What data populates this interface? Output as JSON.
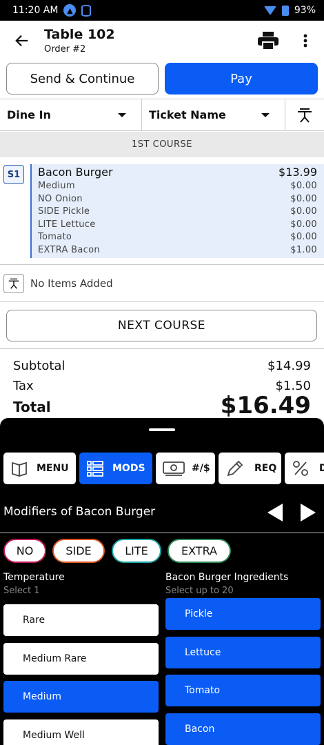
{
  "status": {
    "time": "11:20 AM",
    "battery": "93%"
  },
  "header": {
    "title": "Table 102",
    "subtitle": "Order #2"
  },
  "actions": {
    "send": "Send & Continue",
    "pay": "Pay"
  },
  "dropdowns": {
    "dine": "Dine In",
    "ticket": "Ticket Name"
  },
  "course": {
    "label": "1ST COURSE",
    "seat": "S1"
  },
  "item": {
    "name": "Bacon Burger",
    "price": "$13.99",
    "modifiers": [
      {
        "label": "Medium",
        "price": "$0.00"
      },
      {
        "label": "NO Onion",
        "price": "$0.00"
      },
      {
        "label": "SIDE Pickle",
        "price": "$0.00"
      },
      {
        "label": "LITE Lettuce",
        "price": "$0.00"
      },
      {
        "label": "Tomato",
        "price": "$0.00"
      },
      {
        "label": "EXTRA Bacon",
        "price": "$1.00"
      }
    ]
  },
  "no_items": "No Items Added",
  "next_course": "NEXT COURSE",
  "totals": {
    "subtotal_label": "Subtotal",
    "subtotal": "$14.99",
    "tax_label": "Tax",
    "tax": "$1.50",
    "total_label": "Total",
    "total": "$16.49"
  },
  "tabs": [
    "MENU",
    "MODS",
    "#/$",
    "REQ",
    "D"
  ],
  "active_tab": "MODS",
  "modifiers_title": "Modifiers of Bacon Burger",
  "chips": [
    {
      "label": "NO",
      "color": "#c2185b"
    },
    {
      "label": "SIDE",
      "color": "#e0541f"
    },
    {
      "label": "LITE",
      "color": "#1aa6a6"
    },
    {
      "label": "EXTRA",
      "color": "#2e8b57"
    }
  ],
  "temperature": {
    "title": "Temperature",
    "subtitle": "Select 1",
    "options": [
      "Rare",
      "Medium Rare",
      "Medium",
      "Medium Well"
    ],
    "selected": "Medium"
  },
  "ingredients": {
    "title": "Bacon Burger Ingredients",
    "subtitle": "Select up to 20",
    "options": [
      "Pickle",
      "Lettuce",
      "Tomato",
      "Bacon"
    ]
  },
  "colors": {
    "accent": "#0a5cf5",
    "sheet": "#000000"
  }
}
